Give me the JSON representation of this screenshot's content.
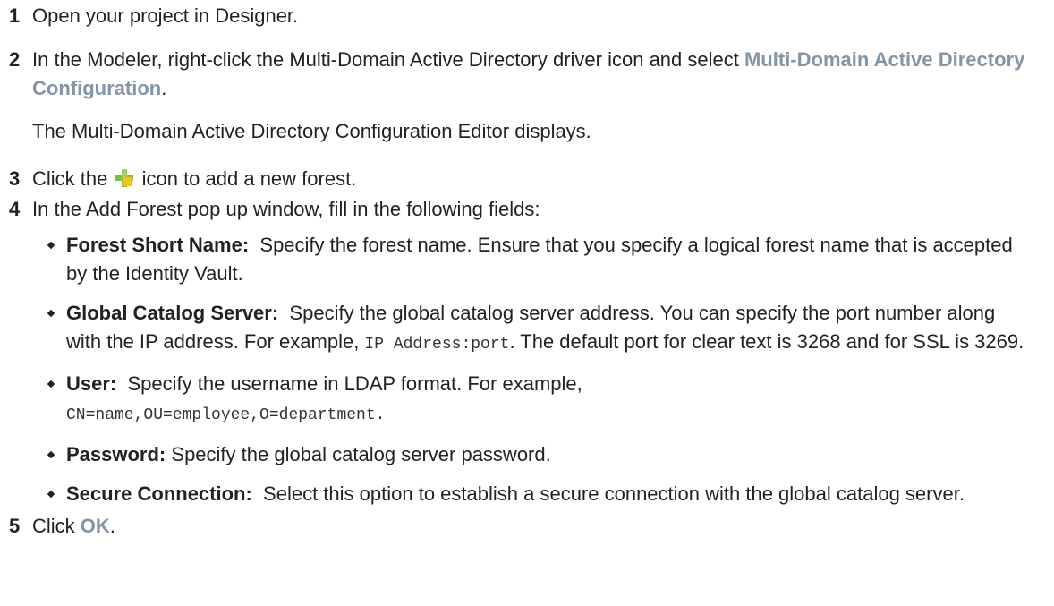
{
  "steps": [
    {
      "number": "1",
      "text": "Open your project in Designer."
    },
    {
      "number": "2",
      "pre": "In the Modeler, right-click the Multi-Domain Active Directory driver icon and select ",
      "ui": "Multi-Domain Active Directory Configuration",
      "post": ".",
      "note": "The Multi-Domain Active Directory Configuration Editor displays."
    },
    {
      "number": "3",
      "pre": "Click the ",
      "icon": "plus-add-icon",
      "post": " icon to add a new forest."
    },
    {
      "number": "4",
      "text": "In the Add Forest pop up window, fill in the following fields:",
      "fields": [
        {
          "label": "Forest Short Name:",
          "text": "Specify the forest name. Ensure that you specify a logical forest name that is accepted by the Identity Vault."
        },
        {
          "label": "Global Catalog Server:",
          "pre": "Specify the global catalog server address. You can specify the port number along with the IP address. For example, ",
          "code": "IP Address:port",
          "post": ". The default port for clear text is 3268 and for SSL is 3269."
        },
        {
          "label": "User:",
          "pre": "Specify the username in LDAP format. For example,",
          "code": "CN=name,OU=employee,O=department",
          "post": "."
        },
        {
          "label": "Password:",
          "text": "Specify the global catalog server password."
        },
        {
          "label": "Secure Connection:",
          "text": "Select this option to establish a secure connection with the global catalog server."
        }
      ]
    },
    {
      "number": "5",
      "pre": "Click ",
      "ui": "OK",
      "post": "."
    }
  ],
  "colors": {
    "text": "#222222",
    "ui_term": "#8296a8",
    "plus_icon_green": "#7cc242",
    "plus_icon_yellow": "#f2c417"
  }
}
